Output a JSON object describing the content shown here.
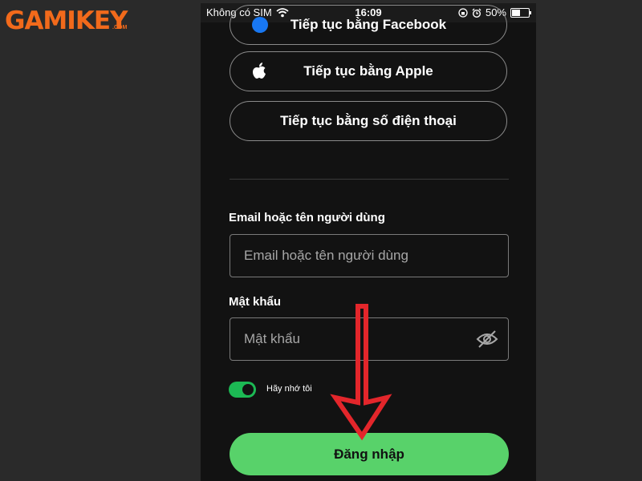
{
  "watermark": {
    "brand": "GAMIKEY",
    "domain": ".COM"
  },
  "status_bar": {
    "carrier": "Không có SIM",
    "time": "16:09",
    "battery": "50%"
  },
  "social_buttons": {
    "facebook_label": "Tiếp tục bằng Facebook",
    "apple_label": "Tiếp tục bằng Apple",
    "phone_label": "Tiếp tục bằng số điện thoại"
  },
  "form": {
    "email_label": "Email hoặc tên người dùng",
    "email_placeholder": "Email hoặc tên người dùng",
    "password_label": "Mật khẩu",
    "password_placeholder": "Mật khẩu",
    "remember_label": "Hãy nhớ tôi",
    "remember_on": true,
    "login_label": "Đăng nhập"
  },
  "colors": {
    "accent_green": "#58d26a",
    "annotation_arrow": "#e3262b",
    "watermark_orange": "#f26a1b"
  },
  "icons": [
    "wifi-icon",
    "lock-rotation-icon",
    "alarm-icon",
    "battery-icon",
    "facebook-icon",
    "apple-icon",
    "eye-off-icon",
    "arrow-down-annotation"
  ]
}
